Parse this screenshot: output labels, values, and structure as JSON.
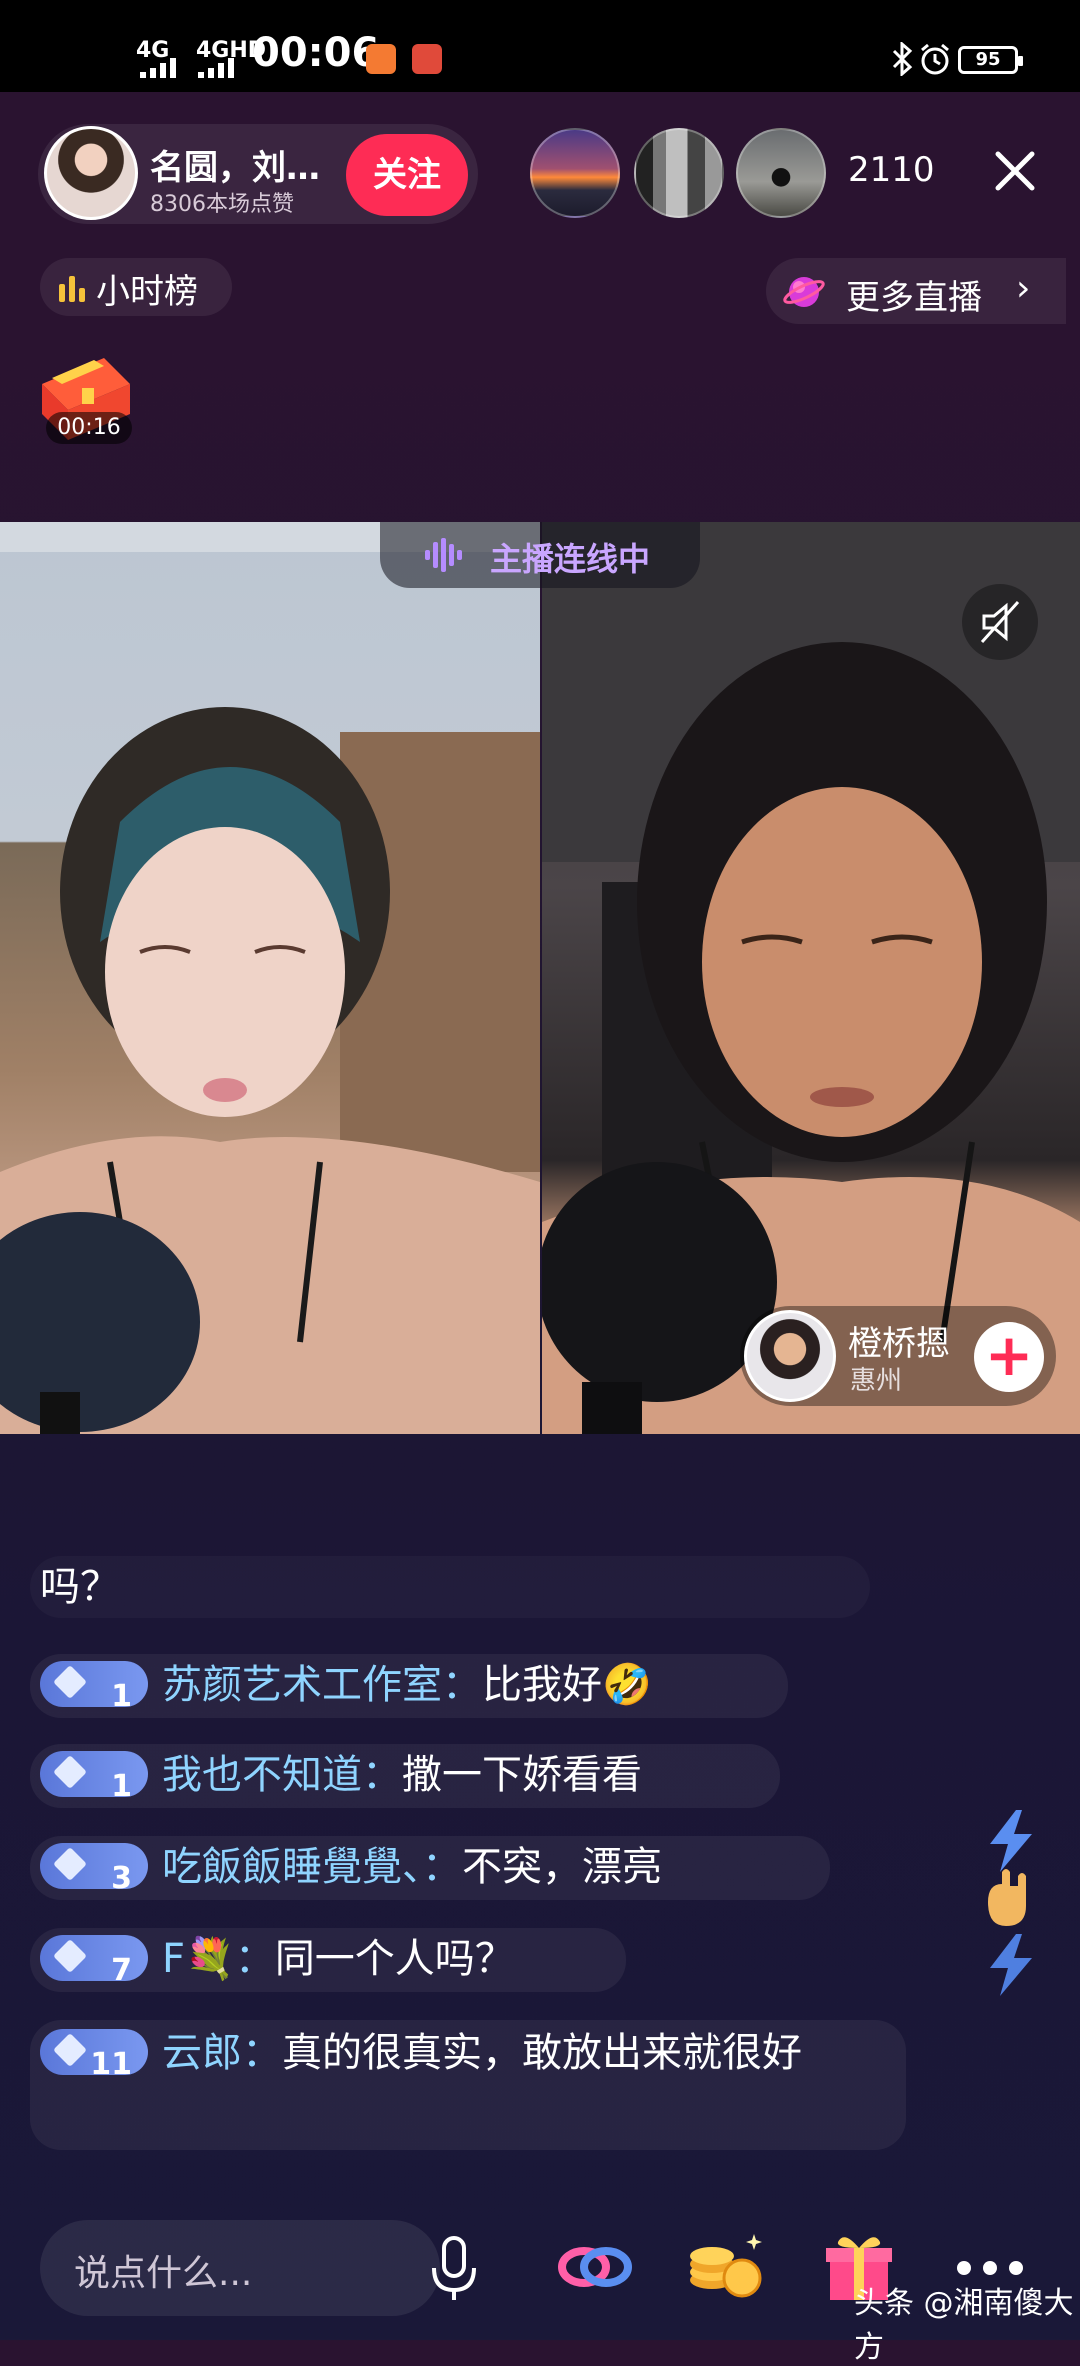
{
  "status_bar": {
    "signal_1": "4G",
    "signal_2": "4GHD",
    "time": "00:06",
    "battery": "95"
  },
  "header": {
    "host_name": "名圆，刘…",
    "host_likes": "8306本场点赞",
    "follow_label": "关注",
    "viewer_count": "2110"
  },
  "rank": {
    "label": "小时榜"
  },
  "more_live": {
    "label": "更多直播"
  },
  "chest": {
    "timer": "00:16"
  },
  "connect": {
    "label": "主播连线中"
  },
  "guest": {
    "name": "橙桥摁",
    "location": "惠州"
  },
  "chat": [
    {
      "user": "",
      "text": "吗？"
    },
    {
      "level": "1",
      "user": "苏颜艺术工作室",
      "text": "比我好🤣"
    },
    {
      "level": "1",
      "user": "我也不知道",
      "text": "撒一下娇看看"
    },
    {
      "level": "3",
      "user": "吃飯飯睡覺覺、",
      "text": "不突，漂亮"
    },
    {
      "level": "7",
      "user": "F💐",
      "text": "同一个人吗？"
    },
    {
      "level": "11",
      "user": "云郎",
      "text": "真的很真实，敢放出来就很好"
    }
  ],
  "colon": "：",
  "bottom_bar": {
    "input_placeholder": "说点什么...",
    "watermark": "头条 @湘南傻大方"
  },
  "colors": {
    "accent": "#fe2c55",
    "username": "#8fd4ff",
    "badge": "#6a88e6",
    "connect": "#c9a6ff"
  }
}
